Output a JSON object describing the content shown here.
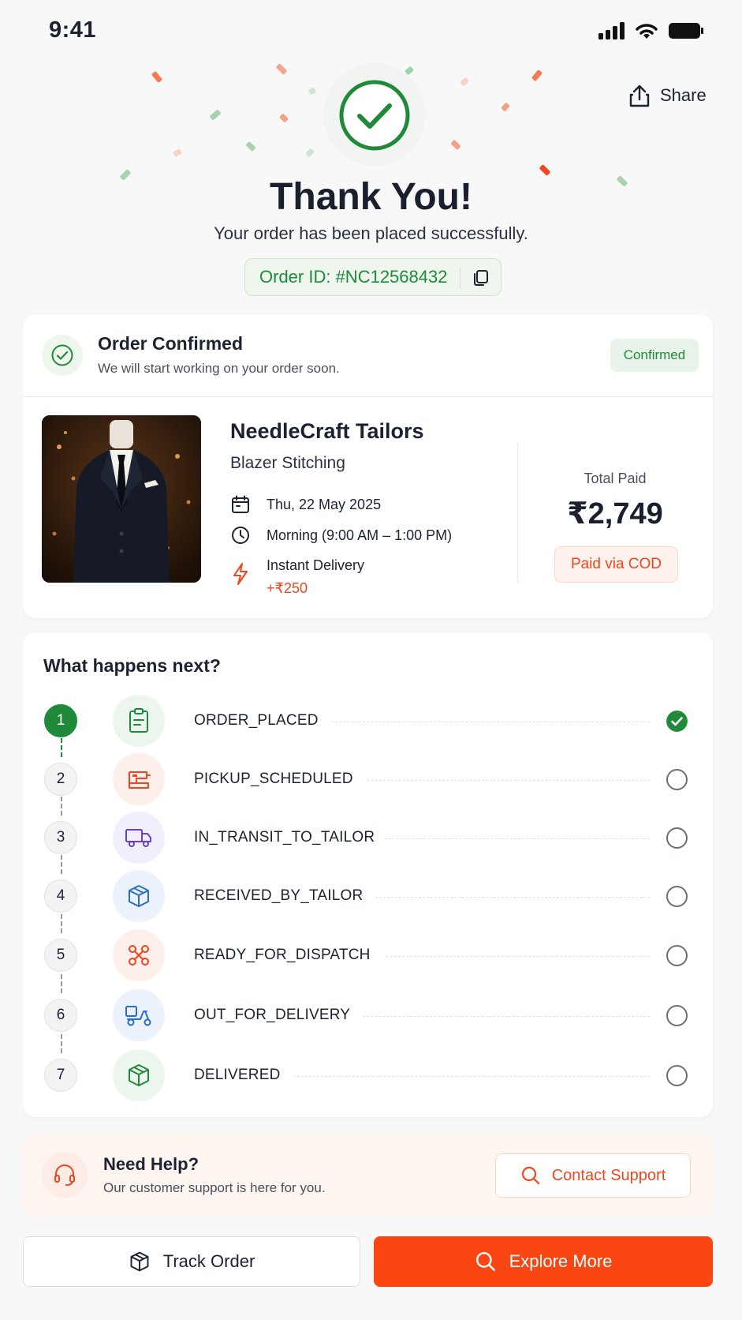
{
  "status_bar": {
    "time": "9:41"
  },
  "header": {
    "share_label": "Share"
  },
  "hero": {
    "title": "Thank You!",
    "subtitle": "Your order has been placed successfully.",
    "order_id": "Order ID: #NC12568432"
  },
  "order_status": {
    "title": "Order Confirmed",
    "subtitle": "We will start working on your order soon.",
    "badge": "Confirmed"
  },
  "order": {
    "shop_name": "NeedleCraft Tailors",
    "service": "Blazer Stitching",
    "date": "Thu, 22 May 2025",
    "slot": "Morning (9:00 AM – 1:00 PM)",
    "delivery_type": "Instant Delivery",
    "delivery_price": "+₹250",
    "total_label": "Total Paid",
    "total_amount": "₹2,749",
    "payment_method": "Paid via COD"
  },
  "next_steps": {
    "title": "What happens next?",
    "steps": [
      {
        "number": "1",
        "label": "ORDER_PLACED",
        "icon": "clipboard-icon",
        "done": true
      },
      {
        "number": "2",
        "label": "PICKUP_SCHEDULED",
        "icon": "sewing-machine-icon",
        "done": false
      },
      {
        "number": "3",
        "label": "IN_TRANSIT_TO_TAILOR",
        "icon": "truck-icon",
        "done": false
      },
      {
        "number": "4",
        "label": "RECEIVED_BY_TAILOR",
        "icon": "package-icon",
        "done": false
      },
      {
        "number": "5",
        "label": "READY_FOR_DISPATCH",
        "icon": "scissors-icon",
        "done": false
      },
      {
        "number": "6",
        "label": "OUT_FOR_DELIVERY",
        "icon": "scooter-icon",
        "done": false
      },
      {
        "number": "7",
        "label": "DELIVERED",
        "icon": "package-delivered-icon",
        "done": false
      }
    ]
  },
  "help": {
    "title": "Need Help?",
    "subtitle": "Our customer support is here for you.",
    "button_label": "Contact Support"
  },
  "actions": {
    "track_label": "Track Order",
    "explore_label": "Explore More"
  },
  "colors": {
    "brand_orange": "#fa4613",
    "success_green": "#1f8a3a",
    "text_dark": "#1d2230"
  }
}
